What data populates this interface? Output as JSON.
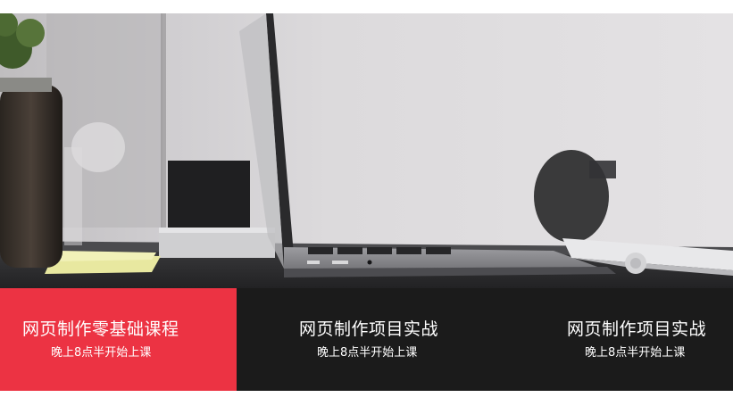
{
  "banner": {
    "image_description": "photo-of-laptop-on-desk"
  },
  "courses": [
    {
      "title": "网页制作零基础课程",
      "subtitle": "晚上8点半开始上课",
      "active": true
    },
    {
      "title": "网页制作项目实战",
      "subtitle": "晚上8点半开始上课",
      "active": false
    },
    {
      "title": "网页制作项目实战",
      "subtitle": "晚上8点半开始上课",
      "active": false
    }
  ],
  "colors": {
    "active_bg": "#ec3343",
    "strip_bg": "#1b1b1b",
    "text": "#ffffff"
  }
}
